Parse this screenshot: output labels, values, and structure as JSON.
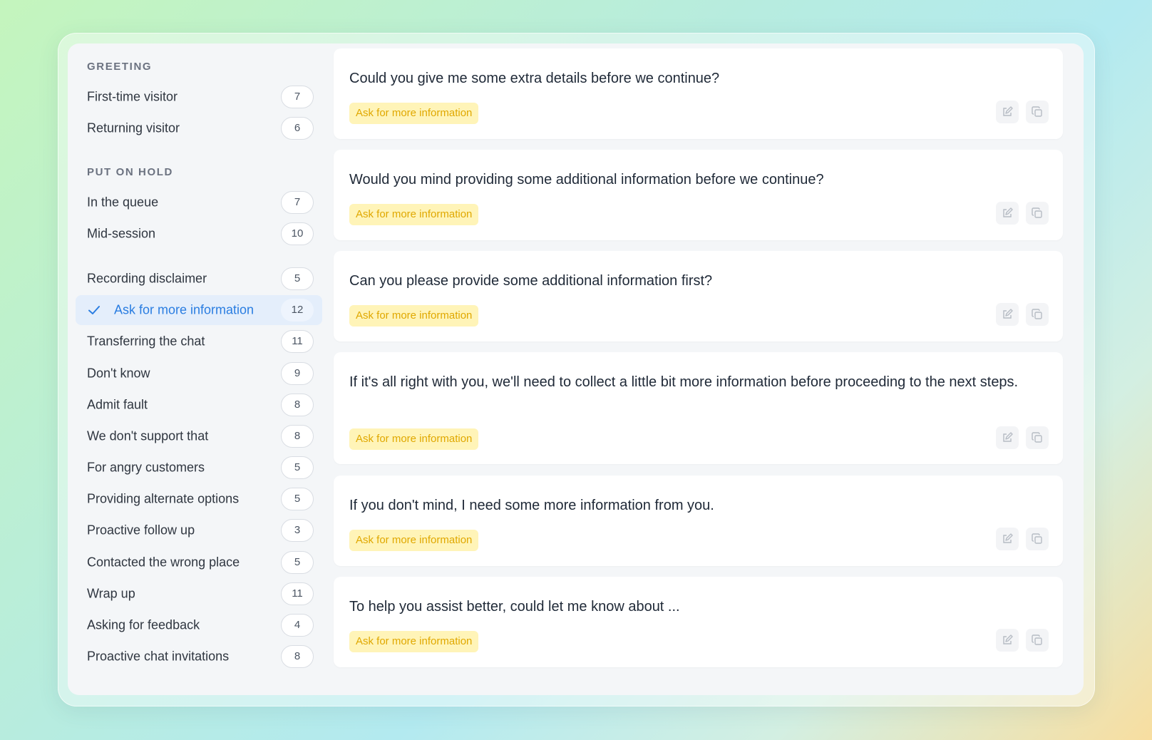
{
  "sidebar": {
    "groups": [
      {
        "title": "GREETING"
      },
      {
        "title": "PUT ON HOLD"
      }
    ],
    "items": [
      {
        "label": "First-time visitor",
        "count": "7"
      },
      {
        "label": "Returning visitor",
        "count": "6"
      },
      {
        "label": "In the queue",
        "count": "7"
      },
      {
        "label": "Mid-session",
        "count": "10"
      },
      {
        "label": "Recording disclaimer",
        "count": "5"
      },
      {
        "label": "Ask for more information",
        "count": "12",
        "active": true
      },
      {
        "label": "Transferring the chat",
        "count": "11"
      },
      {
        "label": "Don't know",
        "count": "9"
      },
      {
        "label": "Admit fault",
        "count": "8"
      },
      {
        "label": "We don't support that",
        "count": "8"
      },
      {
        "label": "For angry customers",
        "count": "5"
      },
      {
        "label": "Providing alternate options",
        "count": "5"
      },
      {
        "label": "Proactive follow up",
        "count": "3"
      },
      {
        "label": "Contacted the wrong place",
        "count": "5"
      },
      {
        "label": "Wrap up",
        "count": "11"
      },
      {
        "label": "Asking for feedback",
        "count": "4"
      },
      {
        "label": "Proactive chat invitations",
        "count": "8"
      }
    ],
    "active_icon": "check-icon"
  },
  "responses": [
    {
      "text": "Could you give me some extra details before we continue?",
      "tag": "Ask for more information"
    },
    {
      "text": "Would you mind providing some additional information before we continue?",
      "tag": "Ask for more information"
    },
    {
      "text": "Can you please provide some additional information first?",
      "tag": "Ask for more information"
    },
    {
      "text": "If it's all right with you, we'll need to collect a little bit more information before proceeding to the next steps.",
      "tag": "Ask for more information"
    },
    {
      "text": "If you don't mind, I need some more information from you.",
      "tag": "Ask for more information"
    },
    {
      "text": "To help you assist better, could let me know about ...",
      "tag": "Ask for more information"
    }
  ],
  "icons": {
    "edit": "edit-icon",
    "copy": "copy-icon"
  },
  "colors": {
    "accent": "#2a7de1",
    "tag_bg": "#fff4b8",
    "tag_text": "#e0a800",
    "active_bg": "#e4eefb"
  }
}
